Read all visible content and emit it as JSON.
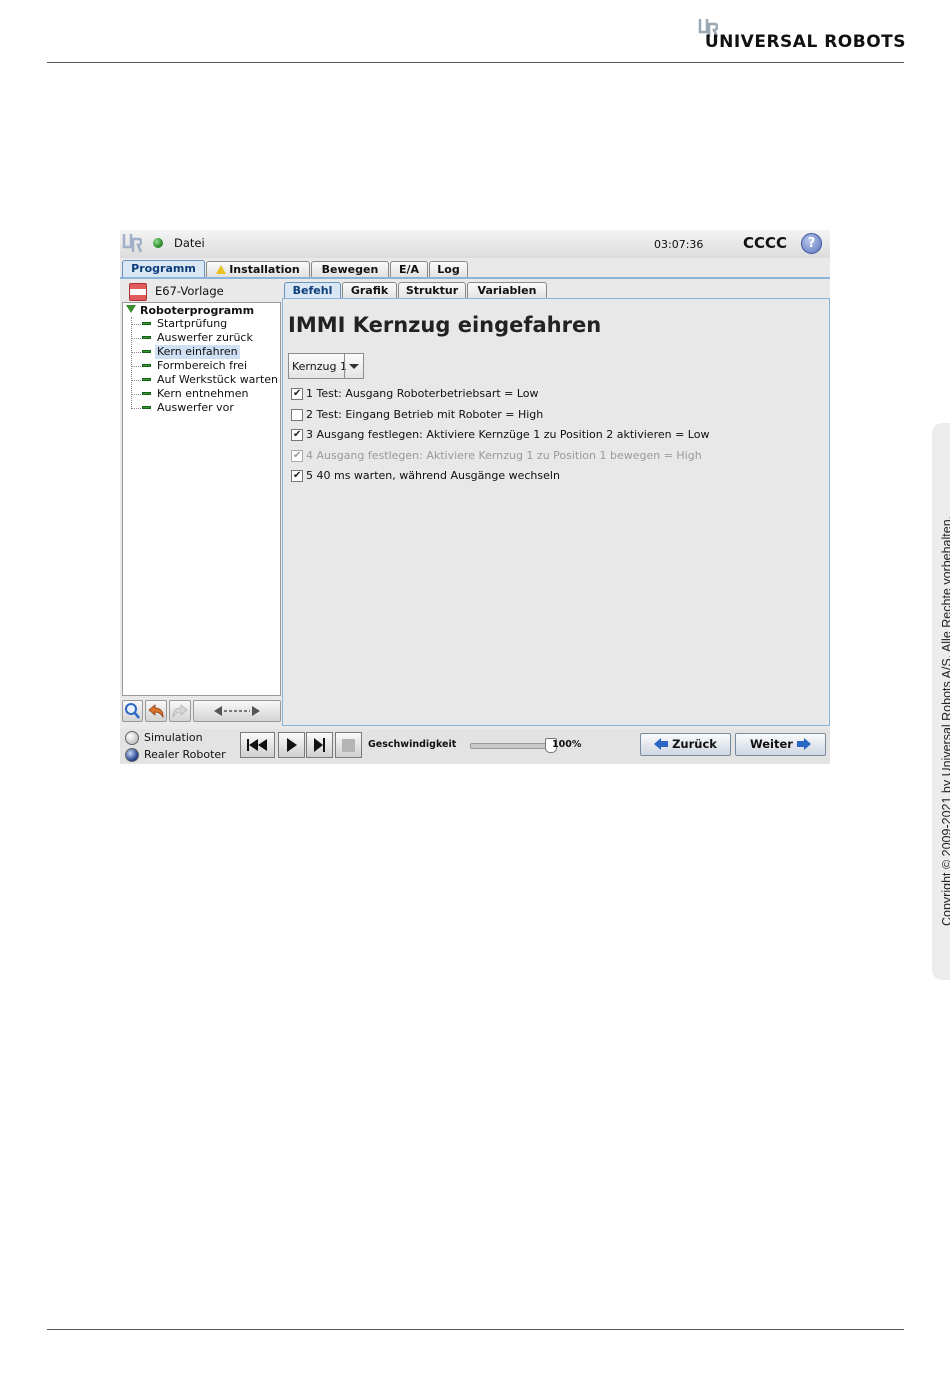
{
  "doc": {
    "brand": "UNIVERSAL ROBOTS",
    "copyright": "Copyright © 2009-2021 by Universal Robots A/S. Alle Rechte vorbehalten."
  },
  "ui": {
    "header": {
      "menu": "Datei",
      "time": "03:07:36",
      "robot_name": "CCCC",
      "help": "?"
    },
    "main_tabs": [
      "Programm",
      "Installation",
      "Bewegen",
      "E/A",
      "Log"
    ],
    "program_file": "E67-Vorlage",
    "tree": {
      "root": "Roboterprogramm",
      "items": [
        "Startprüfung",
        "Auswerfer zurück",
        "Kern einfahren",
        "Formbereich frei",
        "Auf Werkstück warten",
        "Kern entnehmen",
        "Auswerfer vor"
      ],
      "selected_index": 2
    },
    "sub_tabs": [
      "Befehl",
      "Grafik",
      "Struktur",
      "Variablen"
    ],
    "command": {
      "title": "IMMI Kernzug eingefahren",
      "dropdown_value": "Kernzug 1",
      "steps": [
        {
          "text": "1 Test: Ausgang Roboterbetriebsart = Low",
          "checked": true,
          "enabled": true
        },
        {
          "text": "2 Test: Eingang Betrieb mit Roboter = High",
          "checked": false,
          "enabled": true
        },
        {
          "text": "3 Ausgang festlegen: Aktiviere Kernzüge 1 zu Position 2 aktivieren = Low",
          "checked": true,
          "enabled": true
        },
        {
          "text": "4 Ausgang festlegen: Aktiviere Kernzug 1 zu Position 1 bewegen = High",
          "checked": true,
          "enabled": false
        },
        {
          "text": "5 40 ms warten, während Ausgänge wechseln",
          "checked": true,
          "enabled": true
        }
      ]
    },
    "footer": {
      "sim_label": "Simulation",
      "real_label": "Realer Roboter",
      "mode": "real",
      "speed_label": "Geschwindigkeit",
      "speed_value": "100%",
      "speed_fraction": 1.0,
      "back": "Zurück",
      "next": "Weiter"
    }
  },
  "icons": {
    "logo": "ur-logo-icon",
    "status": "status-ok-icon",
    "warning": "warning-icon",
    "save": "save-icon",
    "search": "search-icon",
    "undo": "undo-icon",
    "redo": "redo-icon",
    "move": "move-arrows-icon"
  },
  "colors": {
    "accent_blue": "#8cb3d9",
    "active_tab": "#d9e6f3",
    "node_green": "#2e9b2e",
    "warning_yellow": "#e8c020"
  }
}
